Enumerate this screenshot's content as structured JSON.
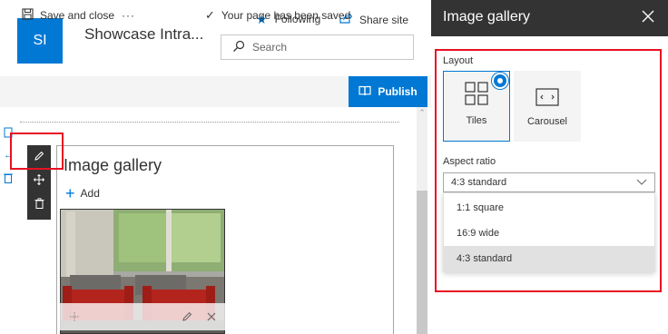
{
  "site": {
    "logo_initials": "SI",
    "title": "Showcase Intra...",
    "following_label": "Following",
    "share_label": "Share site",
    "search_placeholder": "Search"
  },
  "commandbar": {
    "save_close_label": "Save and close",
    "more_label": "···",
    "saved_status": "Your page has been saved",
    "publish_label": "Publish"
  },
  "webpart": {
    "title": "Image gallery",
    "add_label": "Add"
  },
  "pane": {
    "title": "Image gallery",
    "layout_label": "Layout",
    "layouts": [
      {
        "label": "Tiles",
        "selected": true
      },
      {
        "label": "Carousel",
        "selected": false
      }
    ],
    "aspect_label": "Aspect ratio",
    "aspect_value": "4:3 standard",
    "aspect_options": [
      "1:1 square",
      "16:9 wide",
      "4:3 standard"
    ],
    "aspect_selected_index": 2
  },
  "colors": {
    "accent": "#0078d4",
    "header_dark": "#333333",
    "highlight_red": "#e81123"
  },
  "icons": [
    "star-icon",
    "share-icon",
    "search-icon",
    "save-icon",
    "check-icon",
    "publish-icon",
    "pencil-icon",
    "move-icon",
    "trash-icon",
    "plus-icon",
    "close-icon",
    "tiles-icon",
    "carousel-icon",
    "chevron-down-icon"
  ]
}
